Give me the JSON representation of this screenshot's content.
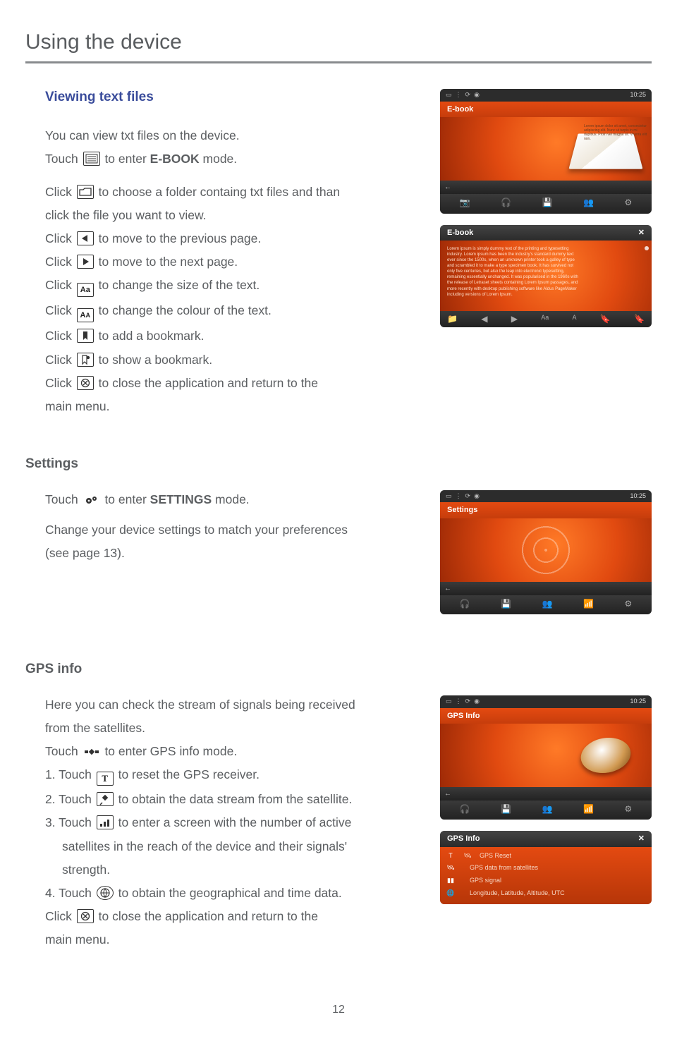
{
  "page": {
    "title": "Using the device",
    "number": "12"
  },
  "viewing": {
    "heading": "Viewing text files",
    "intro": "You can view txt files on the device.",
    "touch_prefix": "Touch ",
    "touch_suffix": " to enter ",
    "ebook_mode": "E-BOOK",
    "mode_word": " mode.",
    "folder_line_a": "Click ",
    "folder_line_b": " to choose a folder containg txt files and than",
    "folder_line_c": "click the file you want to view.",
    "prev_a": "Click ",
    "prev_b": " to move to the previous page.",
    "next_a": "Click ",
    "next_b": " to move to the next page.",
    "size_a": "Click ",
    "size_b": " to change the size of the text.",
    "col_a": "Click ",
    "col_b": " to change the colour of the text.",
    "add_a": "Click ",
    "add_b": " to add a bookmark.",
    "show_a": "Click ",
    "show_b": " to show a bookmark.",
    "close_a": "Click ",
    "close_b": " to close the application and return to the",
    "close_c": "main menu."
  },
  "settings": {
    "heading": "Settings",
    "touch_a": "Touch ",
    "touch_b": " to enter ",
    "label": "SETTINGS",
    "touch_c": " mode.",
    "body_a": "Change your device settings to match your preferences",
    "body_b": "(see page 13)."
  },
  "gps": {
    "heading": "GPS info",
    "intro_a": "Here you can check the stream of signals being received",
    "intro_b": "from the satellites.",
    "touch_a": "Touch ",
    "touch_b": " to enter GPS info mode.",
    "s1_a": "1. Touch ",
    "s1_b": " to reset the GPS receiver.",
    "s2_a": "2. Touch ",
    "s2_b": " to obtain the data stream from the satellite.",
    "s3_a": "3. Touch ",
    "s3_b": " to enter a screen with the number of active",
    "s3_c": "satellites in the reach of the device and their signals'",
    "s3_d": "strength.",
    "s4_a": "4. Touch ",
    "s4_b": " to obtain the geographical and time data.",
    "close_a": "Click ",
    "close_b": " to close the application and return to the",
    "close_c": "main menu."
  },
  "device": {
    "time": "10:25",
    "ebook_title": "E-book",
    "ebook_panel_title": "E-book",
    "settings_title": "Settings",
    "gps_title": "GPS Info",
    "gps_panel_title": "GPS Info",
    "gps_rows": {
      "r1": "GPS Reset",
      "r2": "GPS data from satellites",
      "r3": "GPS signal",
      "r4": "Longitude, Latitude, Altitude, UTC"
    }
  }
}
